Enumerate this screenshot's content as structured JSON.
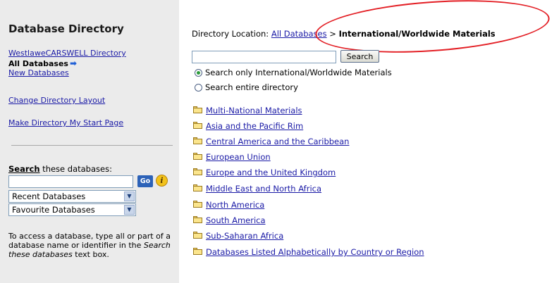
{
  "sidebar": {
    "title": "Database Directory",
    "items": [
      {
        "label": "WestlaweCARSWELL Directory"
      },
      {
        "label": "All Databases"
      },
      {
        "label": "New Databases"
      },
      {
        "label": "Change Directory Layout"
      },
      {
        "label": "Make Directory My Start Page"
      }
    ],
    "search_label_bold": "Search",
    "search_label_rest": " these databases:",
    "go_label": "Go",
    "info_glyph": "i",
    "selects": [
      {
        "value": "Recent Databases"
      },
      {
        "value": "Favourite Databases"
      }
    ],
    "help_part1": "To access a database, type all or part of a database name or identifier in the ",
    "help_italic": "Search these databases",
    "help_part2": " text box."
  },
  "main": {
    "location_label": "Directory Location: ",
    "location_link": "All Databases",
    "location_sep": " > ",
    "location_current": "International/Worldwide Materials",
    "search_button": "Search",
    "radio_options": [
      {
        "label": "Search only International/Worldwide Materials",
        "selected": true
      },
      {
        "label": "Search entire directory",
        "selected": false
      }
    ],
    "categories": [
      "Multi-National Materials",
      "Asia and the Pacific Rim",
      "Central America and the Caribbean",
      "European Union",
      "Europe and the United Kingdom",
      "Middle East and North Africa",
      "North America",
      "South America",
      "Sub-Saharan Africa",
      "Databases Listed Alphabetically by Country or Region"
    ]
  },
  "colors": {
    "link": "#1a1aa6",
    "sidebar_bg": "#ebebeb",
    "annotation_oval": "#e31e24",
    "go_button": "#2c62b8"
  }
}
